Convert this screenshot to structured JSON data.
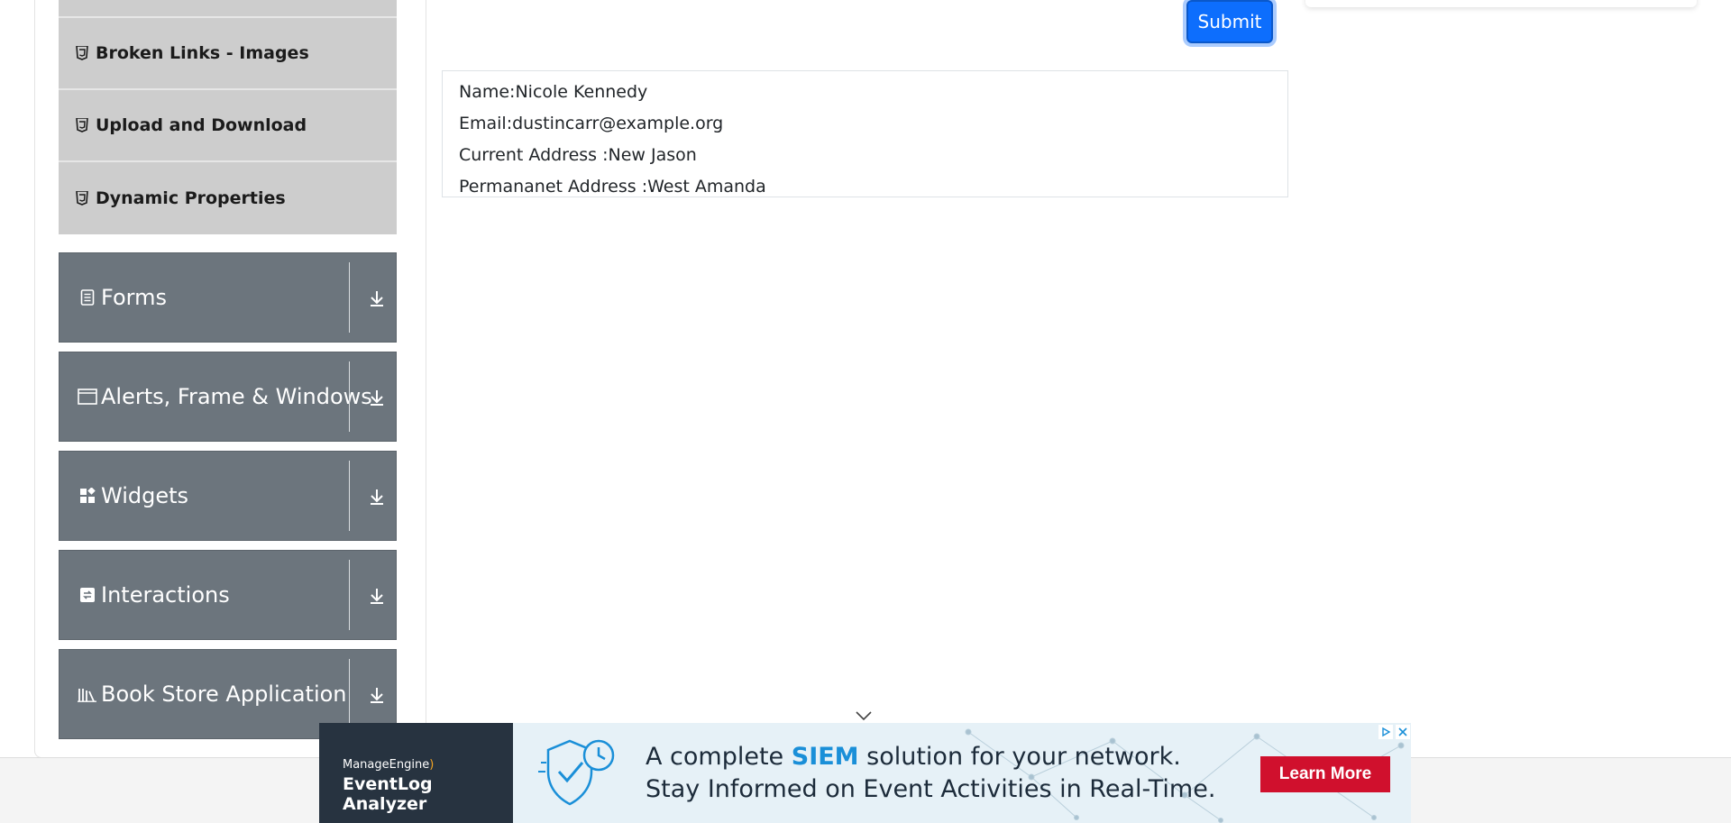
{
  "sidebar": {
    "submenu": [
      {
        "label": "Broken Links - Images",
        "icon": "html5-icon"
      },
      {
        "label": "Upload and Download",
        "icon": "html5-icon"
      },
      {
        "label": "Dynamic Properties",
        "icon": "html5-icon"
      }
    ],
    "groups": [
      {
        "label": "Forms",
        "icon": "form-icon"
      },
      {
        "label": "Alerts, Frame & Windows",
        "icon": "window-icon"
      },
      {
        "label": "Widgets",
        "icon": "widgets-icon"
      },
      {
        "label": "Interactions",
        "icon": "interactions-icon"
      },
      {
        "label": "Book Store Application",
        "icon": "bookstore-icon"
      }
    ]
  },
  "form": {
    "submit_label": "Submit"
  },
  "output": {
    "name": "Name:Nicole Kennedy",
    "email": "Email:dustincarr@example.org",
    "current_address": "Current Address :New Jason",
    "permanent_address": "Permananet Address :West Amanda"
  },
  "ad": {
    "brand": "ManageEngine",
    "product": "EventLog Analyzer",
    "line1_pre": "A complete ",
    "line1_highlight": "SIEM",
    "line1_post": " solution for your network.",
    "line2": "Stay Informed on Event Activities in Real-Time.",
    "cta": "Learn More",
    "colors": {
      "brand_bg": "#273340",
      "cta_bg": "#d0102d",
      "highlight": "#1a8fd8"
    }
  },
  "colors": {
    "accent": "#0d6efd",
    "group_bg": "#6c757d",
    "submenu_bg": "#cdcdcd"
  }
}
